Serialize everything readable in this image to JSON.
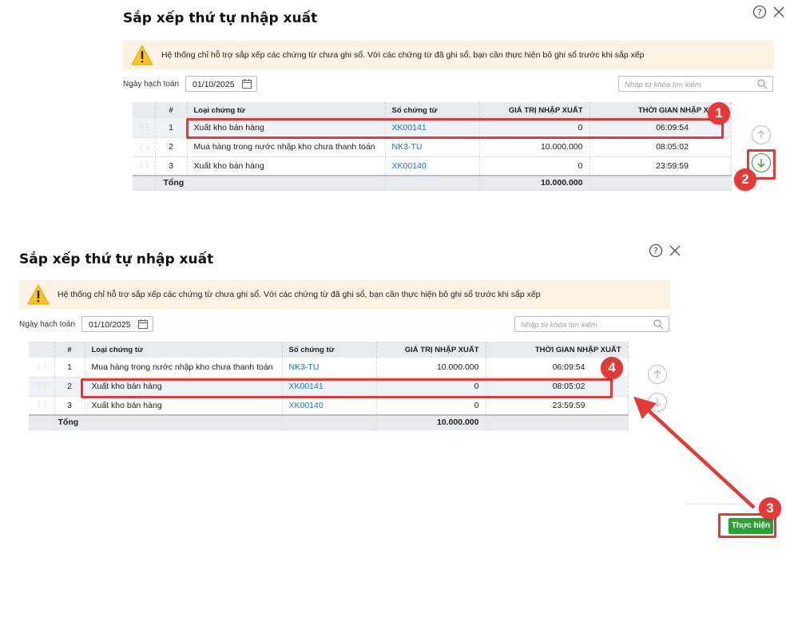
{
  "dialog": {
    "title": "Sắp xếp thứ tự nhập xuất",
    "warning": "Hệ thống chỉ hỗ trợ sắp xếp các chứng từ chưa ghi sổ. Với các chứng từ đã ghi sổ, bạn cần thực hiện bỏ ghi sổ trước khi sắp xếp",
    "date_label": "Ngày hạch toán",
    "date_value": "01/10/2025",
    "search_placeholder": "Nhập từ khóa tìm kiếm",
    "columns": [
      "#",
      "Loại chứng từ",
      "Số chứng từ",
      "GIÁ TRỊ NHẬP XUẤT",
      "THỜI GIAN NHẬP XUẤT"
    ],
    "total_label": "Tổng",
    "total_value": "10.000.000",
    "action_button": "Thực hiện"
  },
  "before": {
    "rows": [
      {
        "no": "1",
        "type": "Xuất kho bán hàng",
        "doc": "XK00141",
        "value": "0",
        "time": "06:09:54"
      },
      {
        "no": "2",
        "type": "Mua hàng trong nước nhập kho chưa thanh toán",
        "doc": "NK3-TU",
        "value": "10.000.000",
        "time": "08:05:02"
      },
      {
        "no": "3",
        "type": "Xuất kho bán hàng",
        "doc": "XK00140",
        "value": "0",
        "time": "23:59:59"
      }
    ]
  },
  "after": {
    "rows": [
      {
        "no": "1",
        "type": "Mua hàng trong nước nhập kho chưa thanh toán",
        "doc": "NK3-TU",
        "value": "10.000.000",
        "time": "06:09:54"
      },
      {
        "no": "2",
        "type": "Xuất kho bán hàng",
        "doc": "XK00141",
        "value": "0",
        "time": "08:05:02"
      },
      {
        "no": "3",
        "type": "Xuất kho bán hàng",
        "doc": "XK00140",
        "value": "0",
        "time": "23:59:59"
      }
    ]
  },
  "steps": [
    "1",
    "2",
    "3",
    "4"
  ],
  "colors": {
    "accent_red": "#e53935",
    "green": "#26a332",
    "link": "#1a73c8",
    "warning_bg": "#fdf1e3"
  },
  "icons": [
    "help-icon",
    "close-icon",
    "warning-icon",
    "calendar-icon",
    "search-icon",
    "arrow-up-icon",
    "arrow-down-icon",
    "drag-handle-icon"
  ]
}
